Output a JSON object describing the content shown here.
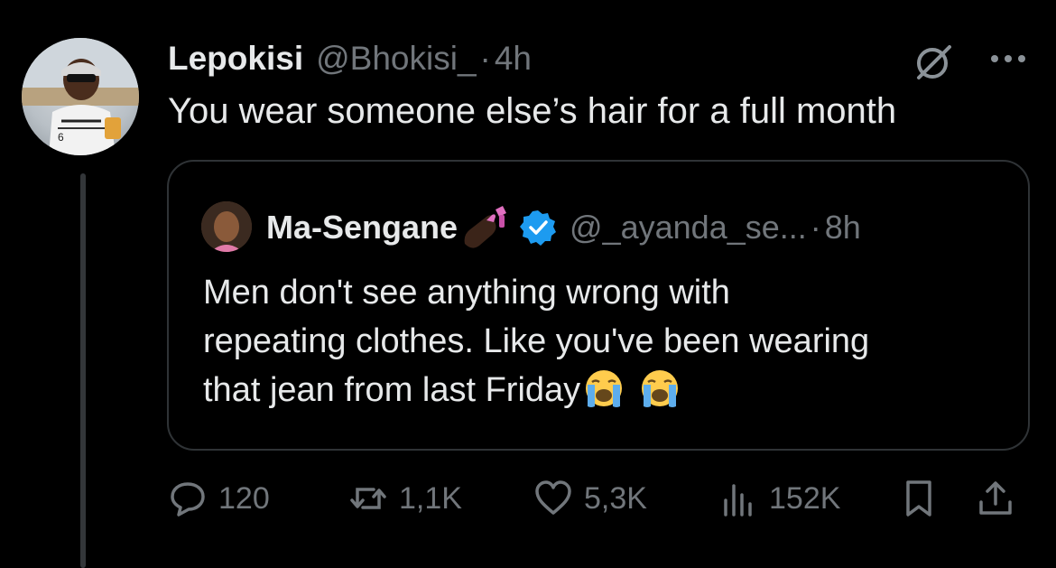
{
  "tweet": {
    "author_name": "Lepokisi",
    "author_handle": "@Bhokisi_",
    "separator": "·",
    "time": "4h",
    "text": "You wear someone else’s hair for a full month"
  },
  "quoted_tweet": {
    "author_name": "Ma-Sengane",
    "author_handle": "@_ayanda_se...",
    "separator": "·",
    "time": "8h",
    "verified": true,
    "text_lines": [
      "Men don't see anything wrong with",
      "repeating clothes. Like you've been wearing",
      "that jean from last Friday"
    ]
  },
  "actions": {
    "replies": "120",
    "reposts": "1,1K",
    "likes": "5,3K",
    "views": "152K"
  },
  "icons": {
    "grok": "grok-icon",
    "more": "more-icon",
    "reply": "reply-icon",
    "repost": "repost-icon",
    "like": "heart-icon",
    "views": "views-icon",
    "bookmark": "bookmark-icon",
    "share": "share-icon",
    "verified": "verified-badge-icon",
    "nail_emoji": "nail-polish-emoji",
    "cry_emoji": "loudly-crying-face-emoji"
  },
  "colors": {
    "background": "#000000",
    "text_primary": "#e7e9ea",
    "text_secondary": "#71767b",
    "border": "#2f3336",
    "verified_blue": "#1d9bf0"
  }
}
